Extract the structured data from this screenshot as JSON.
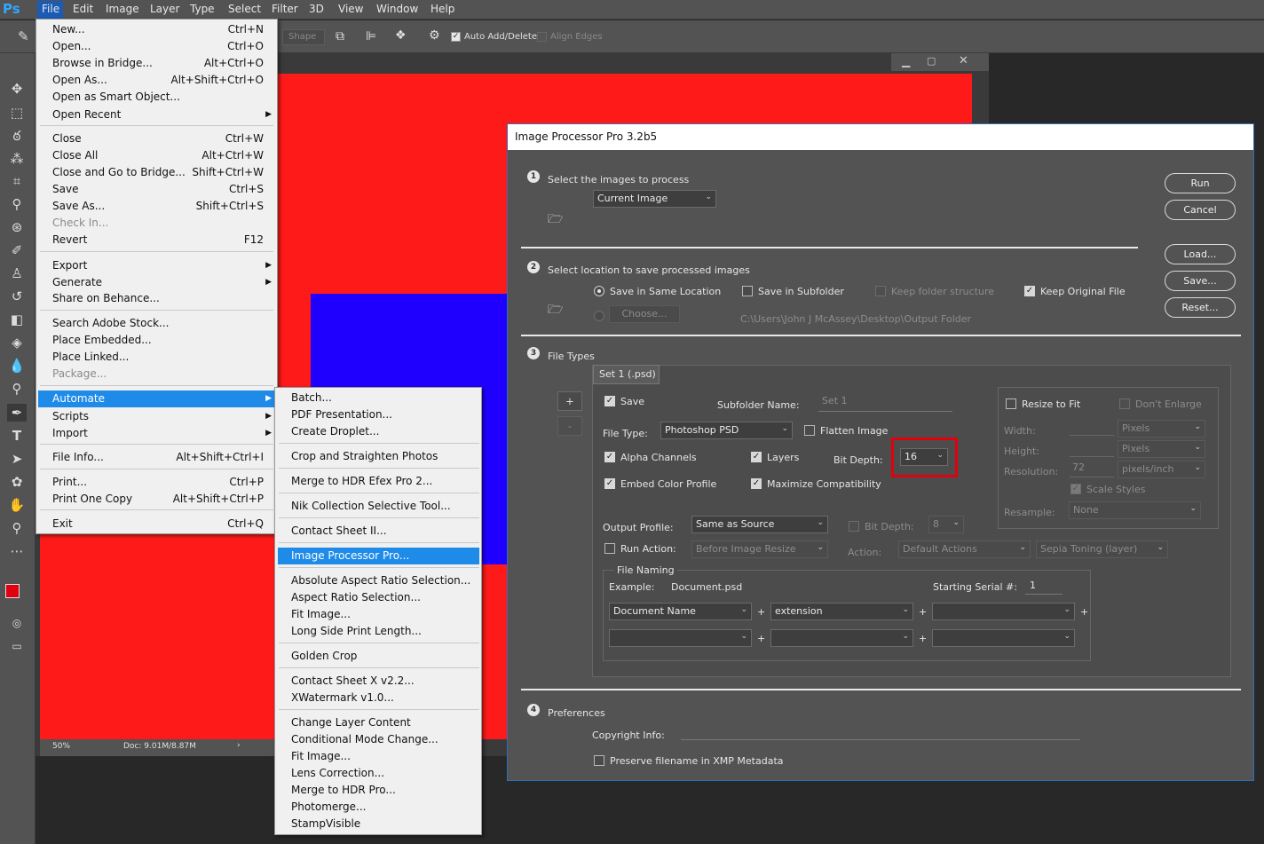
{
  "app": {
    "logo": "Ps"
  },
  "menubar": [
    "File",
    "Edit",
    "Image",
    "Layer",
    "Type",
    "Select",
    "Filter",
    "3D",
    "View",
    "Window",
    "Help"
  ],
  "optbar": {
    "shape": "Shape",
    "auto_add_delete": "Auto Add/Delete",
    "align_edges": "Align Edges"
  },
  "doc_status": {
    "zoom": "50%",
    "doc": "Doc: 9.01M/8.87M"
  },
  "file_menu": [
    {
      "label": "New...",
      "sc": "Ctrl+N"
    },
    {
      "label": "Open...",
      "sc": "Ctrl+O"
    },
    {
      "label": "Browse in Bridge...",
      "sc": "Alt+Ctrl+O"
    },
    {
      "label": "Open As...",
      "sc": "Alt+Shift+Ctrl+O"
    },
    {
      "label": "Open as Smart Object...",
      "sc": ""
    },
    {
      "label": "Open Recent",
      "sc": ""
    },
    {
      "label": "Close",
      "sc": "Ctrl+W"
    },
    {
      "label": "Close All",
      "sc": "Alt+Ctrl+W"
    },
    {
      "label": "Close and Go to Bridge...",
      "sc": "Shift+Ctrl+W"
    },
    {
      "label": "Save",
      "sc": "Ctrl+S"
    },
    {
      "label": "Save As...",
      "sc": "Shift+Ctrl+S"
    },
    {
      "label": "Check In...",
      "sc": ""
    },
    {
      "label": "Revert",
      "sc": "F12"
    },
    {
      "label": "Export",
      "sc": ""
    },
    {
      "label": "Generate",
      "sc": ""
    },
    {
      "label": "Share on Behance...",
      "sc": ""
    },
    {
      "label": "Search Adobe Stock...",
      "sc": ""
    },
    {
      "label": "Place Embedded...",
      "sc": ""
    },
    {
      "label": "Place Linked...",
      "sc": ""
    },
    {
      "label": "Package...",
      "sc": ""
    },
    {
      "label": "Automate",
      "sc": ""
    },
    {
      "label": "Scripts",
      "sc": ""
    },
    {
      "label": "Import",
      "sc": ""
    },
    {
      "label": "File Info...",
      "sc": "Alt+Shift+Ctrl+I"
    },
    {
      "label": "Print...",
      "sc": "Ctrl+P"
    },
    {
      "label": "Print One Copy",
      "sc": "Alt+Shift+Ctrl+P"
    },
    {
      "label": "Exit",
      "sc": "Ctrl+Q"
    }
  ],
  "automate_menu": [
    "Batch...",
    "PDF Presentation...",
    "Create Droplet...",
    "Crop and Straighten Photos",
    "Merge to HDR Efex Pro 2...",
    "Nik Collection Selective Tool...",
    "Contact Sheet II...",
    "Image Processor Pro...",
    "Absolute Aspect Ratio Selection...",
    "Aspect Ratio Selection...",
    "Fit Image...",
    "Long Side Print Length...",
    "Golden Crop",
    "Contact Sheet X v2.2...",
    "XWatermark v1.0...",
    "Change Layer Content",
    "Conditional Mode Change...",
    "Fit Image...",
    "Lens Correction...",
    "Merge to HDR Pro...",
    "Photomerge...",
    "StampVisible"
  ],
  "dialog": {
    "title": "Image Processor Pro 3.2b5",
    "s1": {
      "num": "1",
      "label": "Select the images to process",
      "source": "Current Image"
    },
    "s2": {
      "num": "2",
      "label": "Select location to save processed images",
      "same": "Save in Same Location",
      "subfolder": "Save in Subfolder",
      "keep_struct": "Keep folder structure",
      "keep_orig": "Keep Original File",
      "choose": "Choose...",
      "path": "C:\\Users\\John J McAssey\\Desktop\\Output Folder"
    },
    "s3": {
      "num": "3",
      "label": "File Types",
      "tab": "Set 1 (.psd)",
      "plus": "+",
      "minus": "-",
      "save": "Save",
      "subfolder_name": "Subfolder Name:",
      "subfolder_val": "Set 1",
      "file_type": "File Type:",
      "file_type_val": "Photoshop PSD",
      "flatten": "Flatten Image",
      "alpha": "Alpha Channels",
      "layers": "Layers",
      "bit_depth": "Bit Depth:",
      "bit_depth_val": "16",
      "embed": "Embed Color Profile",
      "maximize": "Maximize Compatibility",
      "resize": "Resize to Fit",
      "dont_enlarge": "Don't Enlarge",
      "width": "Width:",
      "height": "Height:",
      "resolution": "Resolution:",
      "pixels": "Pixels",
      "pixels2": "Pixels",
      "res_val": "72",
      "ppi": "pixels/inch",
      "scale_styles": "Scale Styles",
      "resample": "Resample:",
      "resample_val": "None",
      "out_profile": "Output Profile:",
      "out_profile_val": "Same as Source",
      "bit_depth2": "Bit Depth:",
      "bit_depth2_val": "8",
      "run_action": "Run Action:",
      "action_val": "Before Image Resize",
      "action": "Action:",
      "action_set": "Default Actions",
      "action_name": "Sepia Toning (layer)",
      "naming": "File Naming",
      "example": "Example:",
      "example_val": "Document.psd",
      "serial": "Starting Serial #:",
      "serial_val": "1",
      "n1": "Document Name",
      "n2": "extension"
    },
    "s4": {
      "num": "4",
      "label": "Preferences",
      "copyright": "Copyright Info:",
      "preserve": "Preserve filename in XMP Metadata"
    },
    "buttons": {
      "run": "Run",
      "cancel": "Cancel",
      "load": "Load...",
      "save": "Save...",
      "reset": "Reset..."
    }
  },
  "colors": {
    "highlight": "#1f8be8",
    "accent_red": "#e0000f",
    "canvas_red": "#ff1a1a",
    "canvas_blue": "#1f00ff"
  }
}
